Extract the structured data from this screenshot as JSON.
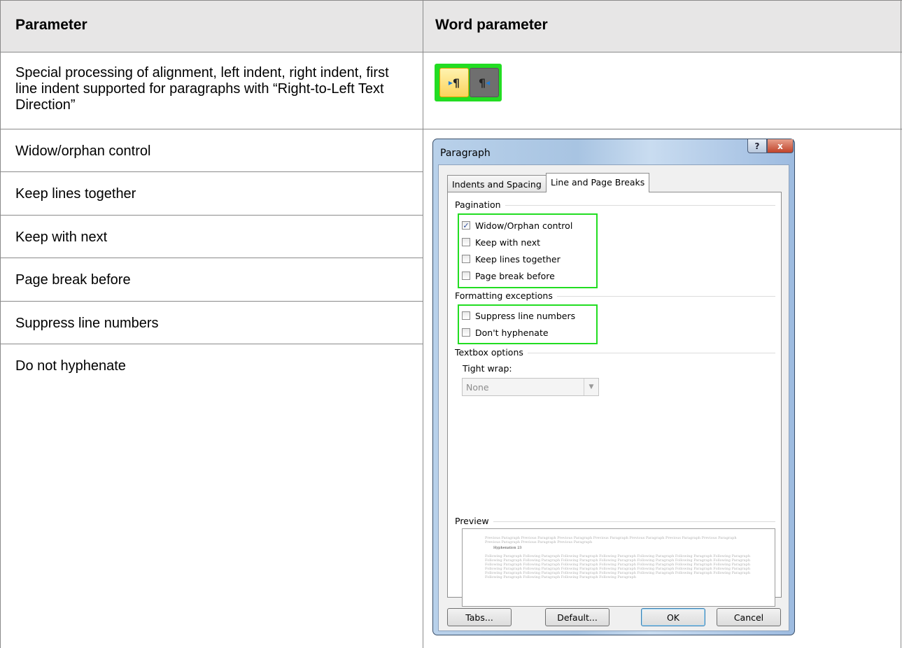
{
  "table": {
    "header": {
      "parameter": "Parameter",
      "word_parameter": "Word parameter"
    },
    "rows": [
      "Special processing of alignment, left indent, right indent, first line indent supported for paragraphs with “Right-to-Left Text Direction”",
      "Widow/orphan control",
      "Keep lines together",
      "Keep with next",
      "Page break before",
      "Suppress line numbers",
      "Do not hyphenate"
    ]
  },
  "rtl_buttons": {
    "ltr_icon": "left-to-right-paragraph-icon",
    "rtl_icon": "right-to-left-paragraph-icon",
    "ltr_glyph": "¶",
    "rtl_glyph": "¶",
    "ltr_arrow": "▸",
    "rtl_arrow": "◂",
    "highlight_color": "#22dd22"
  },
  "dialog": {
    "title": "Paragraph",
    "help_glyph": "?",
    "close_glyph": "x",
    "tabs": [
      "Indents and Spacing",
      "Line and Page Breaks"
    ],
    "active_tab": "Line and Page Breaks",
    "pagination": {
      "label": "Pagination",
      "items": [
        {
          "label": "Widow/Orphan control",
          "checked": true
        },
        {
          "label": "Keep with next",
          "checked": false
        },
        {
          "label": "Keep lines together",
          "checked": false
        },
        {
          "label": "Page break before",
          "checked": false
        }
      ]
    },
    "formatting_exceptions": {
      "label": "Formatting exceptions",
      "items": [
        {
          "label": "Suppress line numbers",
          "checked": false
        },
        {
          "label": "Don't hyphenate",
          "checked": false
        }
      ]
    },
    "textbox_options": {
      "label": "Textbox options",
      "tight_wrap_label": "Tight wrap:",
      "tight_wrap_value": "None"
    },
    "preview": {
      "label": "Preview",
      "previous_text": "Previous Paragraph Previous Paragraph Previous Paragraph Previous Paragraph Previous Paragraph Previous Paragraph Previous Paragraph Previous Paragraph Previous Paragraph Previous Paragraph",
      "current_text": "Hyphenation 23",
      "following_text": "Following Paragraph Following Paragraph Following Paragraph Following Paragraph Following Paragraph Following Paragraph Following Paragraph Following Paragraph Following Paragraph Following Paragraph Following Paragraph Following Paragraph Following Paragraph Following Paragraph Following Paragraph Following Paragraph Following Paragraph Following Paragraph Following Paragraph Following Paragraph Following Paragraph Following Paragraph Following Paragraph Following Paragraph Following Paragraph Following Paragraph Following Paragraph Following Paragraph Following Paragraph Following Paragraph Following Paragraph Following Paragraph Following Paragraph Following Paragraph Following Paragraph Following Paragraph Following Paragraph Following Paragraph Following Paragraph"
    },
    "buttons": {
      "tabs": "Tabs...",
      "default": "Default...",
      "ok": "OK",
      "cancel": "Cancel"
    },
    "highlight_color": "#22dd22"
  }
}
